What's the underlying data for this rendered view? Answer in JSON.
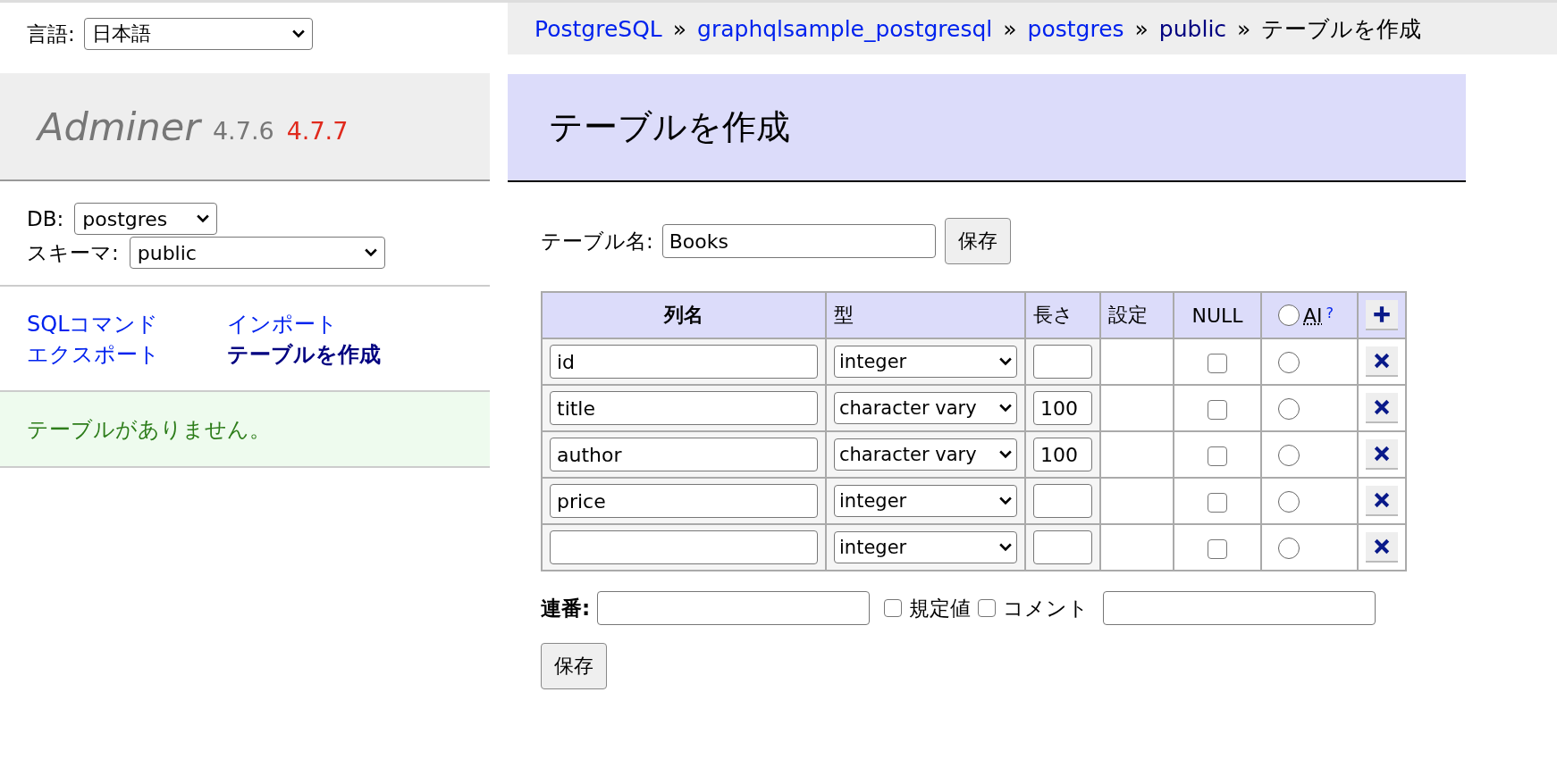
{
  "language": {
    "label": "言語:",
    "value": "日本語"
  },
  "logo": {
    "name": "Adminer",
    "version": "4.7.6",
    "new_version": "4.7.7"
  },
  "db": {
    "label": "DB:",
    "value": "postgres"
  },
  "schema": {
    "label": "スキーマ:",
    "value": "public"
  },
  "links": [
    {
      "label": "SQLコマンド",
      "selected": false
    },
    {
      "label": "インポート",
      "selected": false
    },
    {
      "label": "エクスポート",
      "selected": false
    },
    {
      "label": "テーブルを作成",
      "selected": true
    }
  ],
  "message": "テーブルがありません。",
  "breadcrumb": [
    {
      "label": "PostgreSQL",
      "kind": "link"
    },
    {
      "label": "graphqlsample_postgresql",
      "kind": "link"
    },
    {
      "label": "postgres",
      "kind": "link"
    },
    {
      "label": "public",
      "kind": "visited"
    },
    {
      "label": "テーブルを作成",
      "kind": "text"
    }
  ],
  "breadcrumb_separator": "»",
  "heading": "テーブルを作成",
  "table_name": {
    "label": "テーブル名:",
    "value": "Books"
  },
  "save_button": "保存",
  "columns": [
    {
      "label": "列名",
      "bold": true
    },
    {
      "label": "型",
      "bold": false
    },
    {
      "label": "長さ",
      "bold": false
    },
    {
      "label": "設定",
      "bold": false
    },
    {
      "label": "NULL",
      "bold": false
    }
  ],
  "ai_header": {
    "label": "AI",
    "help": "?",
    "checked": false
  },
  "rows": [
    {
      "name": "id",
      "type": "integer",
      "null": false,
      "ai": false
    },
    {
      "name": "title",
      "type": "character vary",
      "length": "100",
      "null": false,
      "ai": false
    },
    {
      "name": "author",
      "type": "character vary",
      "length": "100",
      "null": false,
      "ai": false
    },
    {
      "name": "price",
      "type": "integer",
      "null": false,
      "ai": false
    },
    {
      "type": "integer",
      "null": false,
      "ai": false
    }
  ],
  "auto_increment": {
    "label": "連番:"
  },
  "defaults": {
    "label": "規定値",
    "checked": false
  },
  "comment": {
    "label": "コメント",
    "checked": false
  },
  "final_button": "保存"
}
